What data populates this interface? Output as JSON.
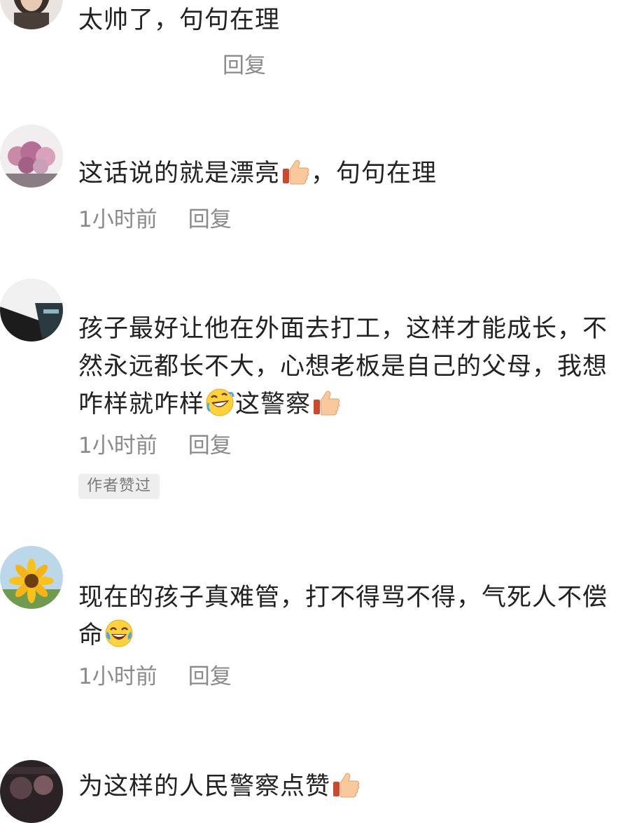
{
  "comments": [
    {
      "text_before": "太帅了，句句在理",
      "text_after": "",
      "reply_label": "回复",
      "time": ""
    },
    {
      "text_before": "这话说的就是漂亮",
      "emoji": "thumbs-up-icon",
      "text_after": "，句句在理",
      "time": "1小时前",
      "reply_label": "回复"
    },
    {
      "text_before": "孩子最好让他在外面去打工，这样才能成长，不然永远都长不大，心想老板是自己的父母，我想咋样就咋样",
      "emoji_1": "rolling-laughing-icon",
      "text_middle": "这警察",
      "emoji_2": "thumbs-up-icon",
      "time": "1小时前",
      "reply_label": "回复",
      "badge": "作者赞过"
    },
    {
      "text_before": "现在的孩子真难管，打不得骂不得，气死人不偿命",
      "emoji": "tears-of-joy-icon",
      "time": "1小时前",
      "reply_label": "回复"
    },
    {
      "text_before": "为这样的人民警察点赞",
      "emoji": "thumbs-up-icon"
    }
  ],
  "colors": {
    "text": "#222222",
    "meta": "#8a8a8a",
    "badge_bg": "#eeeeee"
  }
}
